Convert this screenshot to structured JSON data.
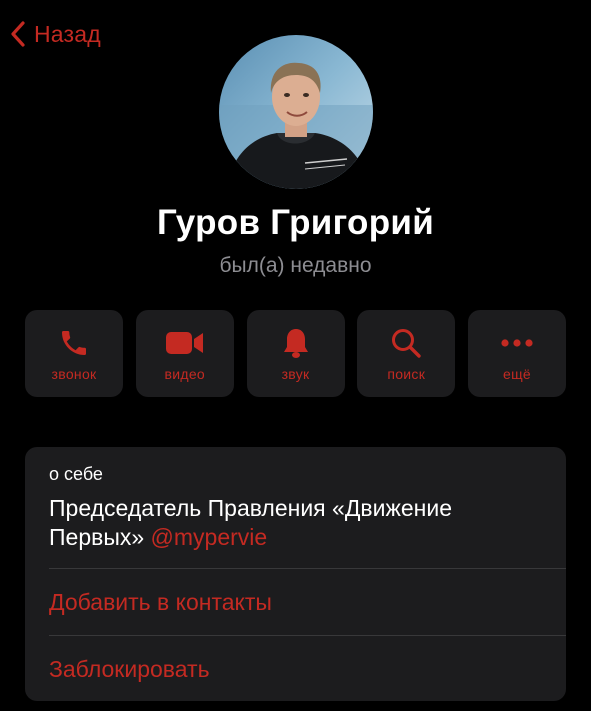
{
  "nav": {
    "back_label": "Назад"
  },
  "profile": {
    "name": "Гуров Григорий",
    "status": "был(а) недавно"
  },
  "actions": [
    {
      "icon": "phone-icon",
      "label": "звонок"
    },
    {
      "icon": "video-camera-icon",
      "label": "видео"
    },
    {
      "icon": "bell-icon",
      "label": "звук"
    },
    {
      "icon": "search-icon",
      "label": "поиск"
    },
    {
      "icon": "more-dots-icon",
      "label": "ещё"
    }
  ],
  "about": {
    "label": "о себе",
    "text_line1": "Председатель Правления «Движение",
    "text_line2": "Первых»",
    "mention": "@mypervie"
  },
  "menu": {
    "add_contact": "Добавить в контакты",
    "block": "Заблокировать"
  },
  "colors": {
    "background": "#000000",
    "accent": "#c42a22",
    "card": "#1c1c1e",
    "secondary_text": "#8d8d92"
  }
}
